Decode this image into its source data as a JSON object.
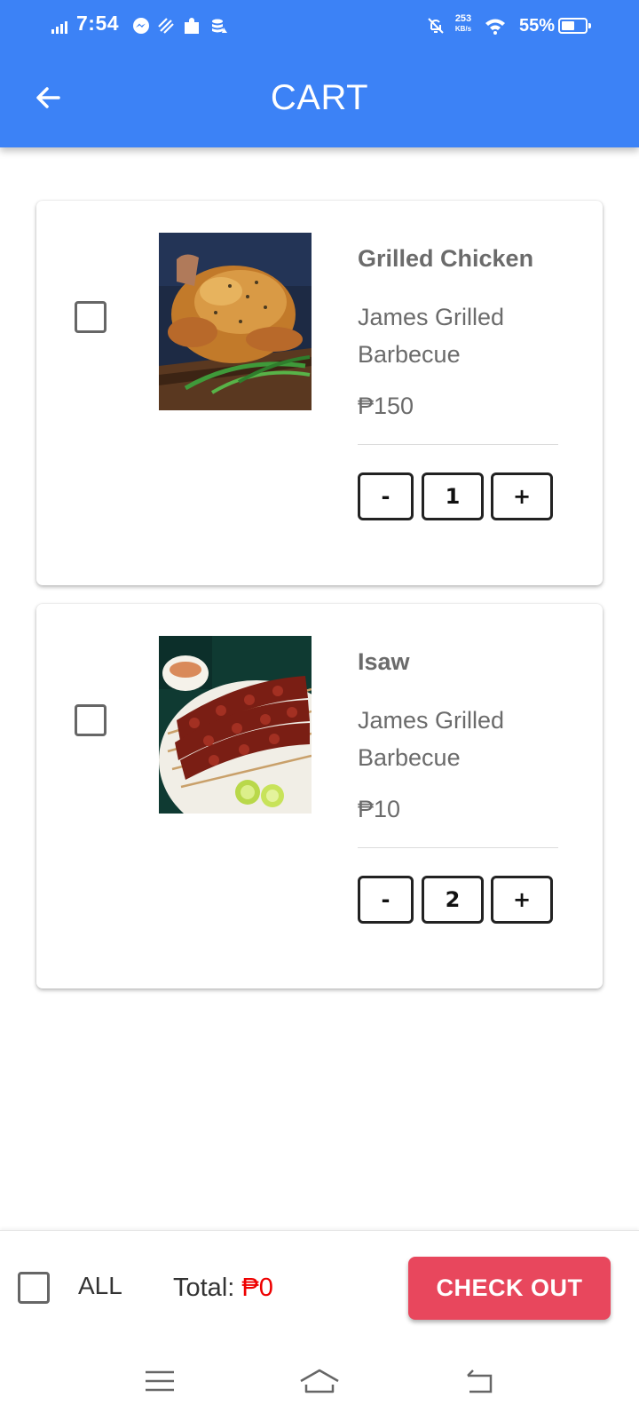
{
  "status_bar": {
    "time": "7:54",
    "net_speed": "253",
    "net_speed_unit": "KB/s",
    "battery_percent": "55%",
    "battery_level": 0.55
  },
  "app_bar": {
    "title": "CART",
    "back_icon": "arrow-left-icon",
    "color": "#3c82f6"
  },
  "cart": {
    "items": [
      {
        "name": "Grilled Chicken",
        "shop": "James Grilled Barbecue",
        "price": "₱150",
        "quantity": "1",
        "minus_label": "-",
        "plus_label": "+",
        "selected": false,
        "image": "grilled-chicken-photo"
      },
      {
        "name": "Isaw",
        "shop": "James Grilled Barbecue",
        "price": "₱10",
        "quantity": "2",
        "minus_label": "-",
        "plus_label": "+",
        "selected": false,
        "image": "isaw-skewers-photo"
      }
    ]
  },
  "footer": {
    "all_label": "ALL",
    "total_label": "Total: ",
    "total_amount": "₱0",
    "checkout_label": "CHECK OUT",
    "checkout_color": "#e8475d",
    "total_color": "#ee0000"
  },
  "nav_bar": {
    "icons": [
      "menu-icon",
      "home-icon",
      "back-icon"
    ]
  }
}
